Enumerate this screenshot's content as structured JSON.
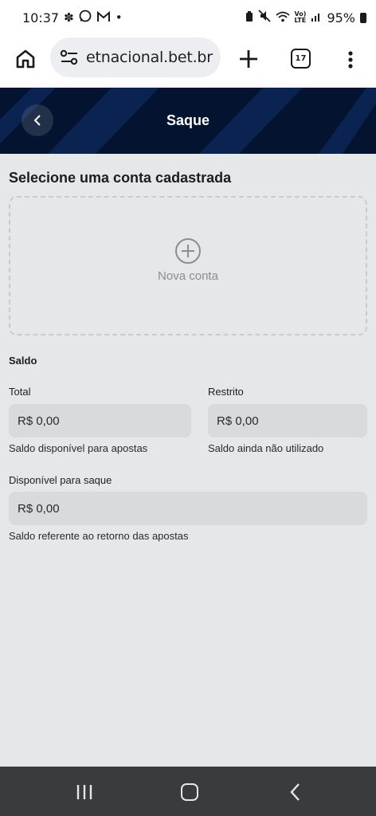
{
  "status_bar": {
    "time": "10:37",
    "left_icons": [
      "flower-notification-icon",
      "whatsapp-icon",
      "gmail-icon",
      "more-notifications-dot"
    ],
    "right_icons": [
      "battery-saver-icon",
      "mute-icon",
      "wifi-icon",
      "volte-icon",
      "signal-icon"
    ],
    "battery": "95%"
  },
  "browser": {
    "url": "etnacional.bet.br",
    "tab_count": "17"
  },
  "header": {
    "title": "Saque"
  },
  "accounts": {
    "section_title": "Selecione uma conta cadastrada",
    "new_account_label": "Nova conta"
  },
  "balance": {
    "title": "Saldo",
    "total_label": "Total",
    "total_value": "R$ 0,00",
    "total_hint": "Saldo disponível para apostas",
    "restricted_label": "Restrito",
    "restricted_value": "R$ 0,00",
    "restricted_hint": "Saldo ainda não utilizado",
    "available_label": "Disponível para saque",
    "available_value": "R$ 0,00",
    "available_hint": "Saldo referente ao retorno das apostas"
  },
  "colors": {
    "header_bg": "#041430",
    "page_bg": "#e6e7e8",
    "field_bg": "#d9dadc",
    "nav_bar_bg": "#3a3b3d"
  }
}
